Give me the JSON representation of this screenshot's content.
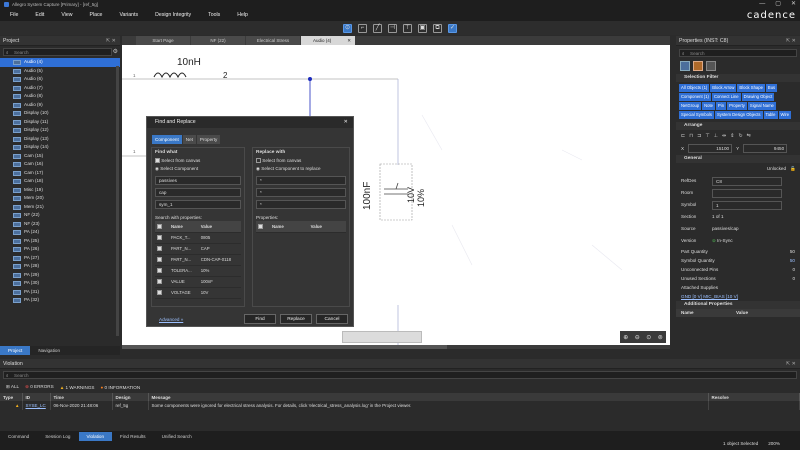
{
  "window": {
    "title": "Allegro System Capture [Primary] - [ref_5g]",
    "minimize": "—",
    "maximize": "▢",
    "close": "✕"
  },
  "menu": [
    "File",
    "Edit",
    "View",
    "Place",
    "Variants",
    "Design Integrity",
    "Tools",
    "Help"
  ],
  "brand": "cadence",
  "project": {
    "title": "Project",
    "search_placeholder": "Search",
    "items": [
      "Audio (4)",
      "Audio (5)",
      "Audio (6)",
      "Audio (7)",
      "Audio (8)",
      "Audio (9)",
      "Display (10)",
      "Display (11)",
      "Display (12)",
      "Display (13)",
      "Display (14)",
      "Cam (15)",
      "Cam (16)",
      "Cam (17)",
      "Cam (18)",
      "Misc (19)",
      "Mem (20)",
      "Mem (21)",
      "NF (22)",
      "NF (23)",
      "PA (24)",
      "PA (25)",
      "PA (26)",
      "PA (27)",
      "PA (28)",
      "PA (29)",
      "PA (30)",
      "PA (31)",
      "PA (32)"
    ],
    "bottom_tabs": [
      "Project",
      "Navigation"
    ]
  },
  "doc_tabs": [
    "Start Page",
    "NF (22)",
    "Electrical Stress",
    "Audio (4)"
  ],
  "canvas": {
    "inductor_value": "10nH",
    "pin1": "1",
    "pin2": "2",
    "cap_ref": "C8",
    "cap_value": "100nF",
    "cap_voltage": "10V",
    "cap_tol": "10%",
    "left_pin": "1"
  },
  "dialog": {
    "title": "Find and Replace",
    "tabs": [
      "Component",
      "Net",
      "Property"
    ],
    "find_what": "Find what",
    "select_from_canvas": "Select from canvas",
    "select_component": "Select Component",
    "fields": [
      "passives",
      "cap",
      "sym_1"
    ],
    "search_with_props": "Search with properties:",
    "props_header": [
      "Name",
      "Value"
    ],
    "props": [
      {
        "name": "PACK_T...",
        "value": "0805"
      },
      {
        "name": "PART_N...",
        "value": "CAP"
      },
      {
        "name": "PART_N...",
        "value": "CDN-CAP-0118"
      },
      {
        "name": "TOLERA...",
        "value": "10%"
      },
      {
        "name": "VALUE",
        "value": "100nF"
      },
      {
        "name": "VOLTAGE",
        "value": "10V"
      }
    ],
    "replace_with": "Replace with",
    "select_component_replace": "Select Component to replace",
    "replace_fields": [
      "*",
      "*",
      "*"
    ],
    "properties_label": "Properties:",
    "advanced": "Advanced »",
    "buttons": [
      "Find",
      "Replace",
      "Cancel"
    ]
  },
  "zoom_icons": [
    "zoom-in",
    "zoom-out",
    "zoom-fit",
    "zoom-area"
  ],
  "properties": {
    "title": "Properties (INST: C8)",
    "search_placeholder": "Search",
    "selection_filter": "Selection Filter",
    "chips": [
      "All Objects (1)",
      "Block Arrow",
      "Block Shape",
      "Bus",
      "Component (1)",
      "Connect Line",
      "Drawing Object",
      "NetGroup",
      "Note",
      "Pin",
      "Property",
      "Signal Name",
      "Special Symbols",
      "System Design Objects",
      "Table",
      "Wire"
    ],
    "arrange": "Arrange",
    "x_label": "X",
    "x_value": "15100",
    "y_label": "Y",
    "y_value": "9450",
    "general": "General",
    "unlocked": "Unlocked",
    "rows": [
      {
        "label": "RefDes",
        "value": "C8"
      },
      {
        "label": "Room",
        "value": ""
      },
      {
        "label": "Symbol",
        "value": "1"
      },
      {
        "label": "Section",
        "value": "1   of  1"
      },
      {
        "label": "Source",
        "value": "passives/cap"
      },
      {
        "label": "Version",
        "value": "In-Sync"
      }
    ],
    "part_quantity_label": "Part Quantity",
    "part_quantity": "50",
    "symbol_quantity_label": "Symbol Quantity",
    "symbol_quantity": "50",
    "unconnected_pins": "Unconnected Pins",
    "unconnected_val": "0",
    "unused_sections": "Unused Sections",
    "unused_val": "0",
    "attached_supplies": "Attached Supplies",
    "supplies": "GND [0 V]  MIC_BIAS [10 V]",
    "additional_props": "Additional Properties",
    "addl_header": [
      "Name",
      "Value"
    ]
  },
  "violation": {
    "title": "Violation",
    "search_placeholder": "Search",
    "filters": {
      "all": "ALL",
      "errors": "0 ERRORS",
      "warnings": "1 WARNINGS",
      "info": "0 INFORMATION"
    },
    "headers": [
      "Type",
      "ID",
      "Time",
      "Design",
      "Message",
      "Resolve"
    ],
    "row": {
      "id": "SYSE_LC",
      "time": "06-Nov-2020 21:48:06",
      "design": "ref_5g",
      "message": "Some components were ignored for electrical stress analysis. For details, click 'electrical_stress_analysis.log' in the Project viewer.",
      "resolve": ""
    }
  },
  "bottom_tabs": [
    "Command",
    "Session Log",
    "Violation",
    "Find Results",
    "Unified Search"
  ],
  "status": {
    "selected": "1 object Selected",
    "zoom": "200%"
  }
}
